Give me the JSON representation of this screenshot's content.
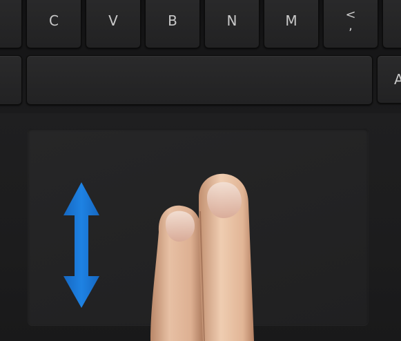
{
  "keyboard": {
    "keys": [
      {
        "id": "left-edge",
        "label": ""
      },
      {
        "id": "c",
        "label": "C"
      },
      {
        "id": "v",
        "label": "V"
      },
      {
        "id": "b",
        "label": "B"
      },
      {
        "id": "n",
        "label": "N"
      },
      {
        "id": "m",
        "label": "M"
      },
      {
        "id": "comma",
        "label": "<",
        "sublabel": ","
      },
      {
        "id": "right-edge",
        "label": ""
      }
    ],
    "space_row": {
      "alt_left": "",
      "spacebar": "",
      "alt_right": "A"
    }
  },
  "gesture": {
    "icon": "vertical-double-arrow-icon",
    "arrow_color": "#1a78d6",
    "fingers": 2,
    "direction": "up-down"
  }
}
